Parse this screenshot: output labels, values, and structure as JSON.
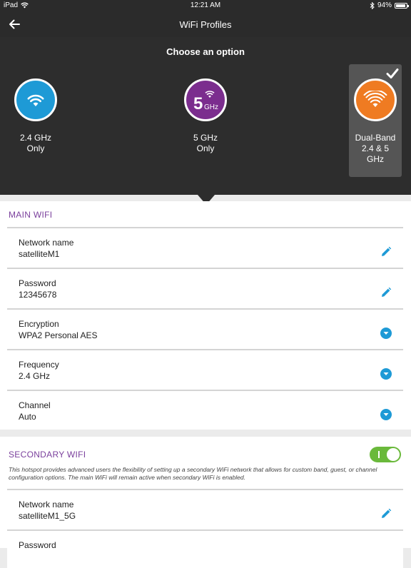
{
  "status_bar": {
    "carrier": "iPad",
    "time": "12:21 AM",
    "battery": "94%",
    "battery_level": 0.94
  },
  "nav": {
    "title": "WiFi Profiles",
    "back_icon": "arrow-left-icon"
  },
  "options": {
    "heading": "Choose an option",
    "items": [
      {
        "label": "2.4 GHz\nOnly",
        "color": "#1e9ad6",
        "icon": "wifi-icon",
        "selected": false
      },
      {
        "label": "5 GHz\nOnly",
        "color": "#7b2d8e",
        "icon": "wifi-5ghz-icon",
        "badge_main": "5",
        "badge_sub": "GHz",
        "selected": false
      },
      {
        "label": "Dual-Band\n2.4 & 5\nGHz",
        "color": "#ef7b22",
        "icon": "wifi-dual-icon",
        "selected": true
      }
    ]
  },
  "main_wifi": {
    "title": "MAIN WIFI",
    "fields": [
      {
        "label": "Network name",
        "value": "satelliteM1",
        "action": "edit"
      },
      {
        "label": "Password",
        "value": "12345678",
        "action": "edit"
      },
      {
        "label": "Encryption",
        "value": "WPA2 Personal AES",
        "action": "dropdown"
      },
      {
        "label": "Frequency",
        "value": "2.4 GHz",
        "action": "dropdown"
      },
      {
        "label": "Channel",
        "value": "Auto",
        "action": "dropdown"
      }
    ]
  },
  "secondary_wifi": {
    "title": "SECONDARY WIFI",
    "toggle_on": true,
    "description": "This hotspot provides advanced users the flexibility of setting up a secondary WiFi network that allows for custom band, guest, or channel configuration options. The main WiFi will remain active when secondary WiFi is enabled.",
    "fields": [
      {
        "label": "Network name",
        "value": "satelliteM1_5G",
        "action": "edit"
      },
      {
        "label": "Password",
        "value": "",
        "action": "edit"
      }
    ]
  },
  "colors": {
    "accent_blue": "#1e9ad6",
    "accent_purple": "#7a3f9c",
    "toggle_green": "#6ab93b",
    "dark_bg": "#2d2d2d"
  }
}
